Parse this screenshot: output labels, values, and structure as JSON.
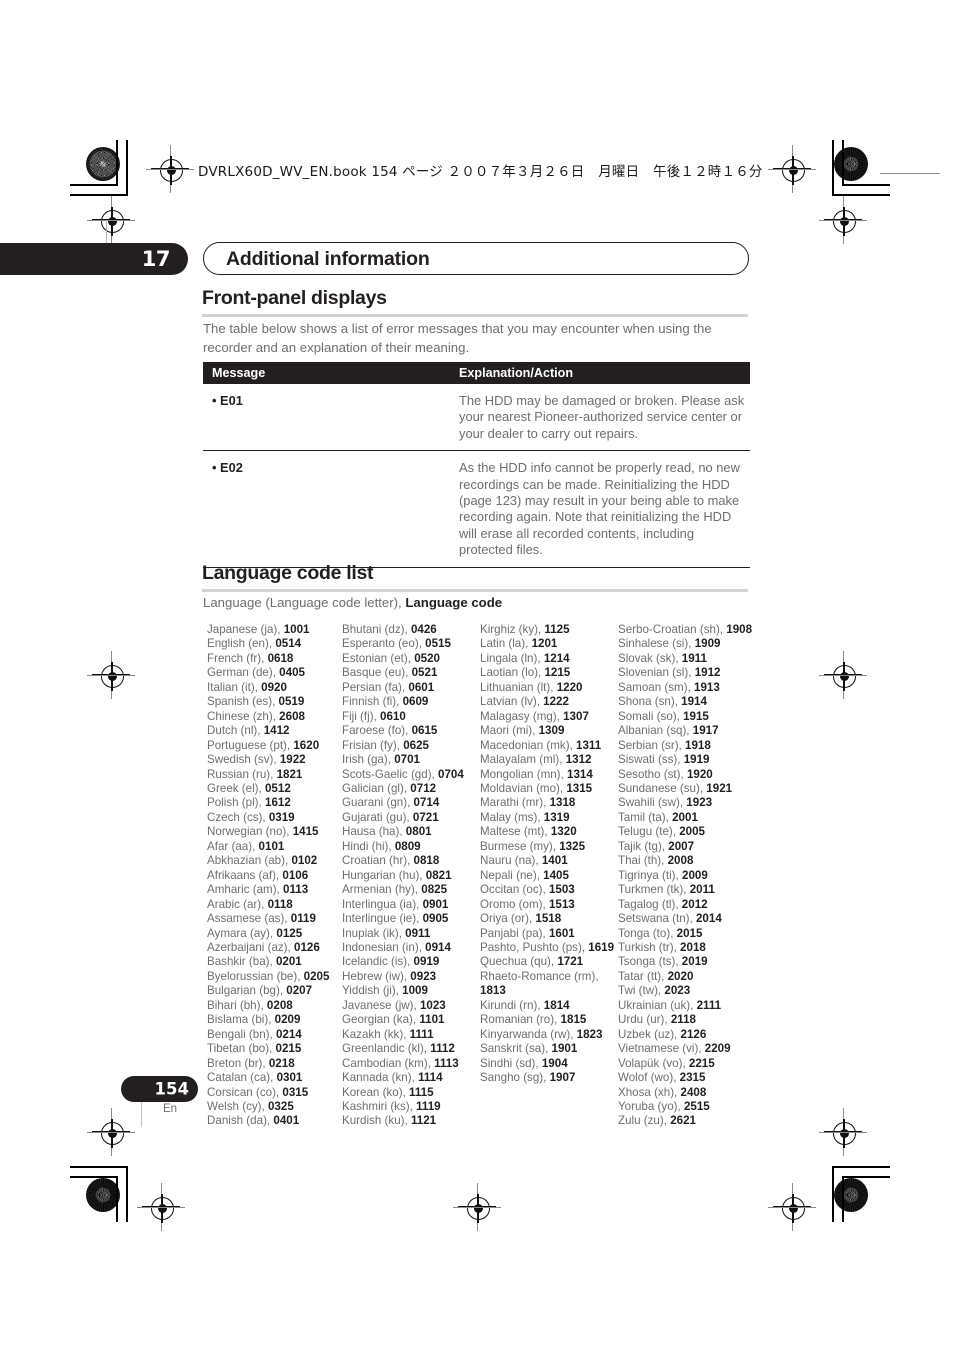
{
  "header": {
    "book_line": "DVRLX60D_WV_EN.book  154 ページ  ２００７年３月２６日　月曜日　午後１２時１６分"
  },
  "chapter": {
    "number": "17",
    "title": "Additional information"
  },
  "sections": {
    "front_panel": {
      "heading": "Front-panel displays",
      "intro": "The table below shows a list of error messages that you may encounter when using the recorder and an explanation of their meaning."
    },
    "language_codes": {
      "heading": "Language code list",
      "note_plain": "Language (Language code letter), ",
      "note_bold": "Language code"
    }
  },
  "error_table": {
    "headers": [
      "Message",
      "Explanation/Action"
    ],
    "rows": [
      {
        "message": "• E01",
        "explanation": "The HDD may be damaged or broken. Please ask your nearest Pioneer-authorized service center or your dealer to carry out repairs."
      },
      {
        "message": "• E02",
        "explanation": "As the HDD info cannot be properly read, no new recordings can be made. Reinitializing the HDD (page 123) may result in your being able to make recording again. Note that reinitializing the HDD will erase all recorded contents, including protected files."
      }
    ]
  },
  "language_columns": [
    [
      {
        "name": "Japanese (ja), ",
        "code": "1001"
      },
      {
        "name": "English (en), ",
        "code": "0514"
      },
      {
        "name": "French (fr), ",
        "code": "0618"
      },
      {
        "name": "German (de), ",
        "code": "0405"
      },
      {
        "name": "Italian (it), ",
        "code": "0920"
      },
      {
        "name": "Spanish (es), ",
        "code": "0519"
      },
      {
        "name": "Chinese (zh), ",
        "code": "2608"
      },
      {
        "name": "Dutch (nl), ",
        "code": "1412"
      },
      {
        "name": "Portuguese (pt), ",
        "code": "1620"
      },
      {
        "name": "Swedish (sv), ",
        "code": "1922"
      },
      {
        "name": "Russian (ru), ",
        "code": "1821"
      },
      {
        "name": "Greek (el), ",
        "code": "0512"
      },
      {
        "name": "Polish (pl), ",
        "code": "1612"
      },
      {
        "name": "Czech (cs), ",
        "code": "0319"
      },
      {
        "name": "Norwegian (no), ",
        "code": "1415"
      },
      {
        "name": "Afar (aa), ",
        "code": "0101"
      },
      {
        "name": "Abkhazian (ab), ",
        "code": "0102"
      },
      {
        "name": "Afrikaans (af), ",
        "code": "0106"
      },
      {
        "name": "Amharic (am), ",
        "code": "0113"
      },
      {
        "name": "Arabic (ar), ",
        "code": "0118"
      },
      {
        "name": "Assamese (as), ",
        "code": "0119"
      },
      {
        "name": "Aymara (ay), ",
        "code": "0125"
      },
      {
        "name": "Azerbaijani (az), ",
        "code": "0126"
      },
      {
        "name": "Bashkir (ba), ",
        "code": "0201"
      },
      {
        "name": "Byelorussian (be), ",
        "code": "0205"
      },
      {
        "name": "Bulgarian (bg), ",
        "code": "0207"
      },
      {
        "name": "Bihari (bh), ",
        "code": "0208"
      },
      {
        "name": "Bislama (bi), ",
        "code": "0209"
      },
      {
        "name": "Bengali (bn), ",
        "code": "0214"
      },
      {
        "name": "Tibetan (bo), ",
        "code": "0215"
      },
      {
        "name": "Breton (br), ",
        "code": "0218"
      },
      {
        "name": "Catalan (ca), ",
        "code": "0301"
      },
      {
        "name": "Corsican (co), ",
        "code": "0315"
      },
      {
        "name": "Welsh (cy), ",
        "code": "0325"
      },
      {
        "name": "Danish (da), ",
        "code": "0401"
      }
    ],
    [
      {
        "name": "Bhutani (dz), ",
        "code": "0426"
      },
      {
        "name": "Esperanto (eo), ",
        "code": "0515"
      },
      {
        "name": "Estonian (et), ",
        "code": "0520"
      },
      {
        "name": "Basque (eu), ",
        "code": "0521"
      },
      {
        "name": "Persian (fa), ",
        "code": "0601"
      },
      {
        "name": "Finnish (fi), ",
        "code": "0609"
      },
      {
        "name": "Fiji (fj), ",
        "code": "0610"
      },
      {
        "name": "Faroese (fo), ",
        "code": "0615"
      },
      {
        "name": "Frisian (fy), ",
        "code": "0625"
      },
      {
        "name": "Irish (ga), ",
        "code": "0701"
      },
      {
        "name": "Scots-Gaelic (gd), ",
        "code": "0704"
      },
      {
        "name": "Galician (gl), ",
        "code": "0712"
      },
      {
        "name": "Guarani (gn), ",
        "code": "0714"
      },
      {
        "name": "Gujarati (gu), ",
        "code": "0721"
      },
      {
        "name": "Hausa (ha), ",
        "code": "0801"
      },
      {
        "name": "Hindi (hi), ",
        "code": "0809"
      },
      {
        "name": "Croatian (hr), ",
        "code": "0818"
      },
      {
        "name": "Hungarian (hu), ",
        "code": "0821"
      },
      {
        "name": "Armenian (hy), ",
        "code": "0825"
      },
      {
        "name": "Interlingua (ia), ",
        "code": "0901"
      },
      {
        "name": "Interlingue (ie), ",
        "code": "0905"
      },
      {
        "name": "Inupiak (ik), ",
        "code": "0911"
      },
      {
        "name": "Indonesian (in), ",
        "code": "0914"
      },
      {
        "name": "Icelandic (is), ",
        "code": "0919"
      },
      {
        "name": "Hebrew (iw), ",
        "code": "0923"
      },
      {
        "name": "Yiddish (ji), ",
        "code": "1009"
      },
      {
        "name": "Javanese (jw), ",
        "code": "1023"
      },
      {
        "name": "Georgian (ka), ",
        "code": "1101"
      },
      {
        "name": "Kazakh (kk), ",
        "code": "1111"
      },
      {
        "name": "Greenlandic (kl), ",
        "code": "1112"
      },
      {
        "name": "Cambodian (km), ",
        "code": "1113"
      },
      {
        "name": "Kannada (kn), ",
        "code": "1114"
      },
      {
        "name": "Korean (ko), ",
        "code": "1115"
      },
      {
        "name": "Kashmiri (ks), ",
        "code": "1119"
      },
      {
        "name": "Kurdish (ku), ",
        "code": "1121"
      }
    ],
    [
      {
        "name": "Kirghiz (ky), ",
        "code": "1125"
      },
      {
        "name": "Latin (la), ",
        "code": "1201"
      },
      {
        "name": "Lingala (ln), ",
        "code": "1214"
      },
      {
        "name": "Laotian (lo), ",
        "code": "1215"
      },
      {
        "name": "Lithuanian (lt), ",
        "code": "1220"
      },
      {
        "name": "Latvian (lv), ",
        "code": "1222"
      },
      {
        "name": "Malagasy (mg), ",
        "code": "1307"
      },
      {
        "name": "Maori (mi), ",
        "code": "1309"
      },
      {
        "name": "Macedonian (mk), ",
        "code": "1311"
      },
      {
        "name": "Malayalam (ml), ",
        "code": "1312"
      },
      {
        "name": "Mongolian (mn), ",
        "code": "1314"
      },
      {
        "name": "Moldavian (mo), ",
        "code": "1315"
      },
      {
        "name": "Marathi (mr), ",
        "code": "1318"
      },
      {
        "name": "Malay (ms), ",
        "code": "1319"
      },
      {
        "name": "Maltese (mt), ",
        "code": "1320"
      },
      {
        "name": "Burmese (my), ",
        "code": "1325"
      },
      {
        "name": "Nauru (na), ",
        "code": "1401"
      },
      {
        "name": "Nepali (ne), ",
        "code": "1405"
      },
      {
        "name": "Occitan (oc), ",
        "code": "1503"
      },
      {
        "name": "Oromo (om), ",
        "code": "1513"
      },
      {
        "name": "Oriya (or), ",
        "code": "1518"
      },
      {
        "name": "Panjabi (pa), ",
        "code": "1601"
      },
      {
        "name": "Pashto, Pushto (ps), ",
        "code": "1619"
      },
      {
        "name": "Quechua (qu), ",
        "code": "1721"
      },
      {
        "name": "Rhaeto-Romance (rm), ",
        "code": "1813",
        "wrap": true
      },
      {
        "name": "Kirundi (rn), ",
        "code": "1814"
      },
      {
        "name": "Romanian (ro), ",
        "code": "1815"
      },
      {
        "name": "Kinyarwanda (rw), ",
        "code": "1823"
      },
      {
        "name": "Sanskrit (sa), ",
        "code": "1901"
      },
      {
        "name": "Sindhi (sd), ",
        "code": "1904"
      },
      {
        "name": "Sangho (sg), ",
        "code": "1907"
      }
    ],
    [
      {
        "name": "Serbo-Croatian (sh), ",
        "code": "1908"
      },
      {
        "name": "Sinhalese (si), ",
        "code": "1909"
      },
      {
        "name": "Slovak (sk), ",
        "code": "1911"
      },
      {
        "name": "Slovenian (sl), ",
        "code": "1912"
      },
      {
        "name": "Samoan (sm), ",
        "code": "1913"
      },
      {
        "name": "Shona (sn), ",
        "code": "1914"
      },
      {
        "name": "Somali (so), ",
        "code": "1915"
      },
      {
        "name": "Albanian (sq), ",
        "code": "1917"
      },
      {
        "name": "Serbian (sr), ",
        "code": "1918"
      },
      {
        "name": "Siswati (ss), ",
        "code": "1919"
      },
      {
        "name": "Sesotho (st), ",
        "code": "1920"
      },
      {
        "name": "Sundanese (su), ",
        "code": "1921"
      },
      {
        "name": "Swahili (sw), ",
        "code": "1923"
      },
      {
        "name": "Tamil (ta), ",
        "code": "2001"
      },
      {
        "name": "Telugu (te), ",
        "code": "2005"
      },
      {
        "name": "Tajik (tg), ",
        "code": "2007"
      },
      {
        "name": "Thai (th), ",
        "code": "2008"
      },
      {
        "name": "Tigrinya (ti), ",
        "code": "2009"
      },
      {
        "name": "Turkmen (tk), ",
        "code": "2011"
      },
      {
        "name": "Tagalog (tl), ",
        "code": "2012"
      },
      {
        "name": "Setswana (tn), ",
        "code": "2014"
      },
      {
        "name": "Tonga (to), ",
        "code": "2015"
      },
      {
        "name": "Turkish (tr), ",
        "code": "2018"
      },
      {
        "name": "Tsonga (ts), ",
        "code": "2019"
      },
      {
        "name": "Tatar (tt), ",
        "code": "2020"
      },
      {
        "name": "Twi (tw), ",
        "code": "2023"
      },
      {
        "name": "Ukrainian (uk), ",
        "code": "2111"
      },
      {
        "name": "Urdu (ur), ",
        "code": "2118"
      },
      {
        "name": "Uzbek (uz), ",
        "code": "2126"
      },
      {
        "name": "Vietnamese (vi), ",
        "code": "2209"
      },
      {
        "name": "Volapük (vo), ",
        "code": "2215"
      },
      {
        "name": "Wolof (wo), ",
        "code": "2315"
      },
      {
        "name": "Xhosa (xh), ",
        "code": "2408"
      },
      {
        "name": "Yoruba (yo), ",
        "code": "2515"
      },
      {
        "name": "Zulu (zu), ",
        "code": "2621"
      }
    ]
  ],
  "footer": {
    "page_number": "154",
    "language_mark": "En"
  }
}
